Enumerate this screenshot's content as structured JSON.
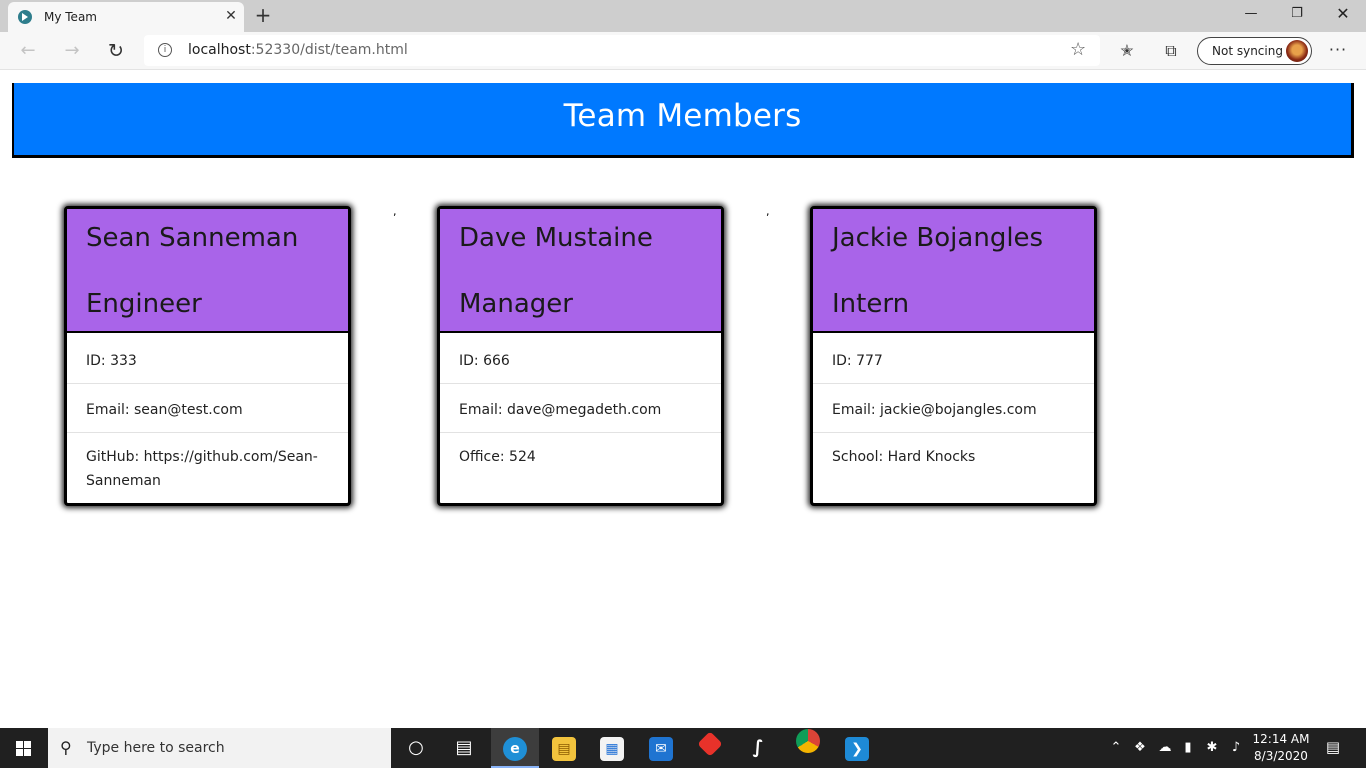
{
  "browser": {
    "tab_title": "My Team",
    "tab_close": "✕",
    "new_tab": "+",
    "url_host": "localhost",
    "url_rest": ":52330/dist/team.html",
    "sync_label": "Not syncing",
    "more": "···"
  },
  "page": {
    "title": "Team Members",
    "stray_marks": [
      ",",
      ","
    ],
    "members": [
      {
        "name": "Sean Sanneman",
        "role": "Engineer",
        "id": "ID: 333",
        "email": "Email: sean@test.com",
        "extra": "GitHub: https://github.com/Sean-Sanneman"
      },
      {
        "name": "Dave Mustaine",
        "role": "Manager",
        "id": "ID: 666",
        "email": "Email: dave@megadeth.com",
        "extra": "Office: 524"
      },
      {
        "name": "Jackie Bojangles",
        "role": "Intern",
        "id": "ID: 777",
        "email": "Email: jackie@bojangles.com",
        "extra": "School: Hard Knocks"
      }
    ]
  },
  "taskbar": {
    "search_placeholder": "Type here to search",
    "time": "12:14 AM",
    "date": "8/3/2020"
  },
  "colors": {
    "header_blue": "#0079ff",
    "card_header_purple": "#a964e9"
  }
}
